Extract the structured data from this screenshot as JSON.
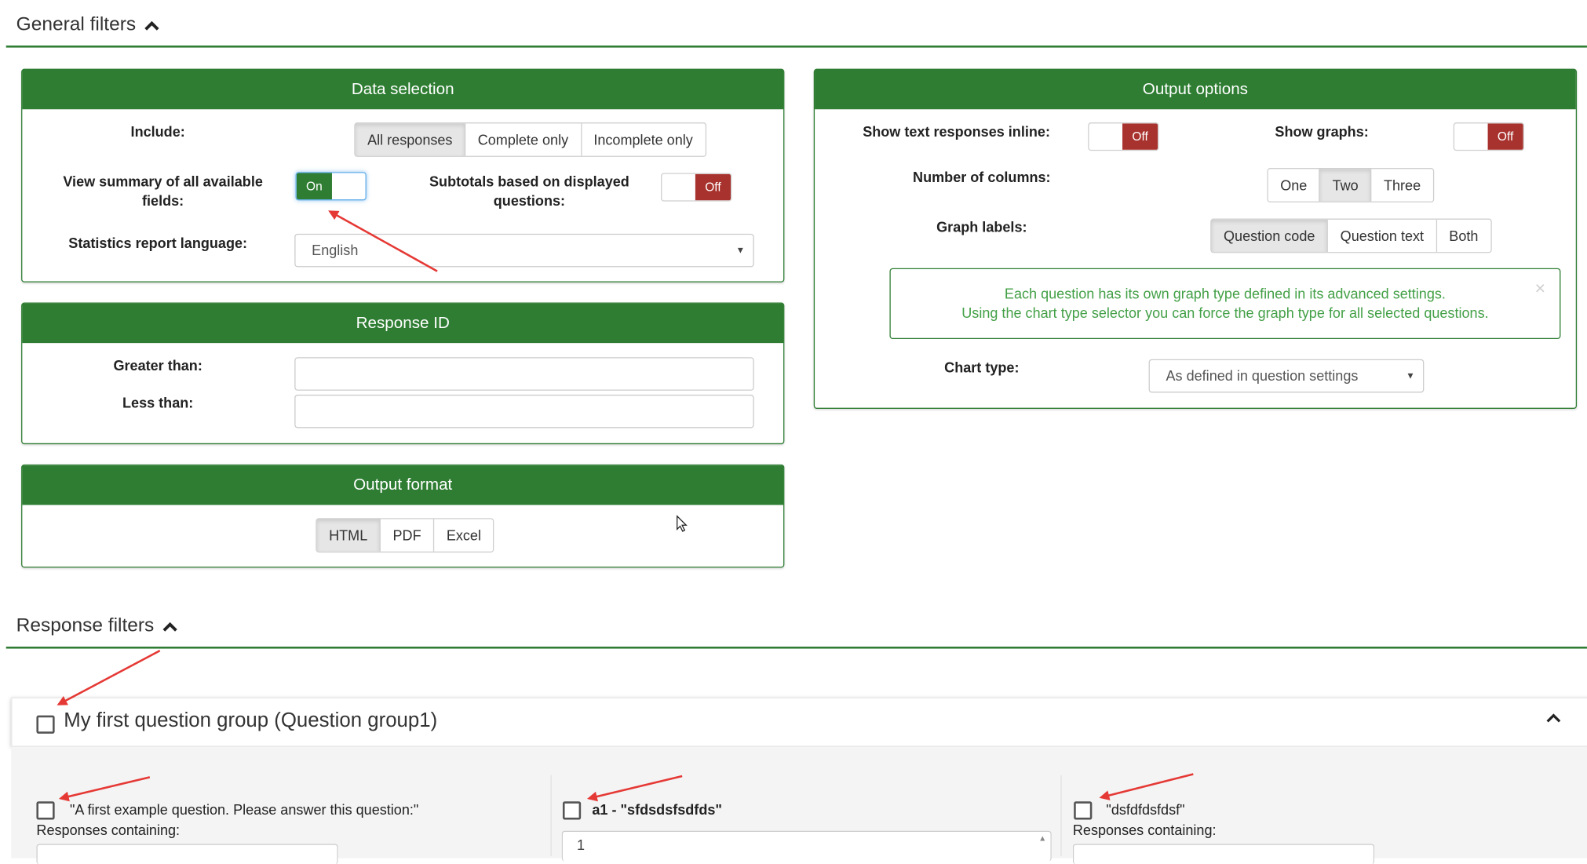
{
  "general_filters": {
    "title": "General filters"
  },
  "data_selection": {
    "title": "Data selection",
    "include_label": "Include:",
    "include_options": [
      "All responses",
      "Complete only",
      "Incomplete only"
    ],
    "view_summary_label": "View summary of all available fields:",
    "view_summary_toggle": "On",
    "subtotals_label": "Subtotals based on displayed questions:",
    "subtotals_toggle": "Off",
    "language_label": "Statistics report language:",
    "language_value": "English"
  },
  "response_id": {
    "title": "Response ID",
    "greater_label": "Greater than:",
    "less_label": "Less than:"
  },
  "output_format": {
    "title": "Output format",
    "options": [
      "HTML",
      "PDF",
      "Excel"
    ]
  },
  "output_options": {
    "title": "Output options",
    "inline_label": "Show text responses inline:",
    "inline_toggle": "Off",
    "graphs_label": "Show graphs:",
    "graphs_toggle": "Off",
    "columns_label": "Number of columns:",
    "columns_options": [
      "One",
      "Two",
      "Three"
    ],
    "graph_labels_label": "Graph labels:",
    "graph_labels_options": [
      "Question code",
      "Question text",
      "Both"
    ],
    "info_line1": "Each question has its own graph type defined in its advanced settings.",
    "info_line2": "Using the chart type selector you can force the graph type for all selected questions.",
    "info_close": "×",
    "chart_type_label": "Chart type:",
    "chart_type_value": "As defined in question settings"
  },
  "response_filters": {
    "title": "Response filters",
    "group_title": "My first question group (Question group1)",
    "questions": [
      {
        "text": "\"A first example question. Please answer this question:\"",
        "sub": "Responses containing:"
      },
      {
        "text": "a1 - \"sfdsdsfsdfds\"",
        "value": "1"
      },
      {
        "text": "\"dsfdfdsfdsf\"",
        "sub": "Responses containing:"
      }
    ]
  },
  "colors": {
    "accent": "#2e7d32",
    "off": "#a8322d",
    "info_text": "#43a047",
    "arrow": "#e53935"
  }
}
